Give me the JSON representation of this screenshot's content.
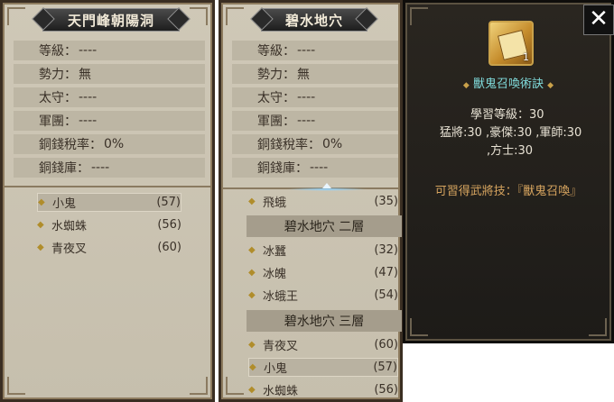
{
  "panel1": {
    "title": "天門峰朝陽洞",
    "info": [
      {
        "label": "等級：",
        "value": "----"
      },
      {
        "label": "勢力：",
        "value": "無"
      },
      {
        "label": "太守：",
        "value": "----"
      },
      {
        "label": "軍團：",
        "value": "----"
      },
      {
        "label": "銅錢稅率：",
        "value": "0%"
      },
      {
        "label": "銅錢庫：",
        "value": "----"
      }
    ],
    "monsters": [
      {
        "name": "小鬼",
        "level": "(57)"
      },
      {
        "name": "水蜘蛛",
        "level": "(56)"
      },
      {
        "name": "青夜叉",
        "level": "(60)"
      }
    ]
  },
  "panel2": {
    "title": "碧水地穴",
    "info": [
      {
        "label": "等級：",
        "value": "----"
      },
      {
        "label": "勢力：",
        "value": "無"
      },
      {
        "label": "太守：",
        "value": "----"
      },
      {
        "label": "軍團：",
        "value": "----"
      },
      {
        "label": "銅錢稅率：",
        "value": "0%"
      },
      {
        "label": "銅錢庫：",
        "value": "----"
      }
    ],
    "top_monster": {
      "name": "飛蛾",
      "level": "(35)"
    },
    "floor2": {
      "title": "碧水地穴 二層",
      "monsters": [
        {
          "name": "冰蠶",
          "level": "(32)"
        },
        {
          "name": "冰魄",
          "level": "(47)"
        },
        {
          "name": "冰蛾王",
          "level": "(54)"
        }
      ]
    },
    "floor3": {
      "title": "碧水地穴 三層",
      "monsters": [
        {
          "name": "青夜叉",
          "level": "(60)"
        },
        {
          "name": "小鬼",
          "level": "(57)"
        },
        {
          "name": "水蜘蛛",
          "level": "(56)"
        }
      ]
    }
  },
  "detail": {
    "item_count": "1",
    "item_name": "獸鬼召喚術訣",
    "close_label": "✕",
    "stat_lines": [
      "學習等級：30",
      "猛將:30 ,豪傑:30 ,軍師:30",
      ",方士:30"
    ],
    "skill_text": "可習得武將技：『獸鬼召喚』"
  },
  "colors": {
    "accent_teal": "#7fd9d9",
    "gold": "#c9a14a",
    "skill_orange": "#d6a45f"
  }
}
